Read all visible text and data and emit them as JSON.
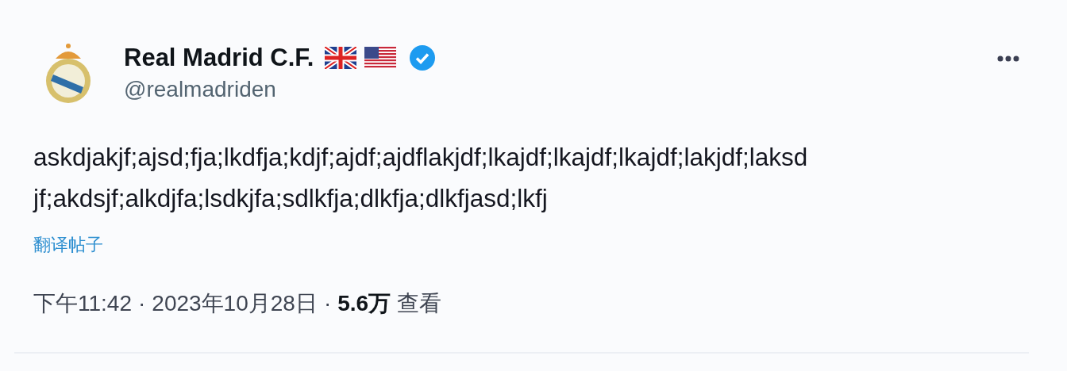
{
  "author": {
    "name": "Real Madrid C.F.",
    "handle": "@realmadriden",
    "verified": true,
    "flags": [
      {
        "kind": "uk"
      },
      {
        "kind": "us"
      }
    ]
  },
  "text": "askdjakjf;ajsd;fja;lkdfja;kdjf;ajdf;ajdflakjdf;lkajdf;lkajdf;lkajdf;lakjdf;laksd\njf;akdsjf;alkdjfa;lsdkjfa;sdlkfja;dlkfja;dlkfjasd;lkfj",
  "translate_link": "翻译帖子",
  "meta": {
    "time": "下午11:42",
    "separator_1": "·",
    "date": "2023年10月28日",
    "separator_2": "·",
    "views_count": "5.6万",
    "views_label": "查看"
  }
}
